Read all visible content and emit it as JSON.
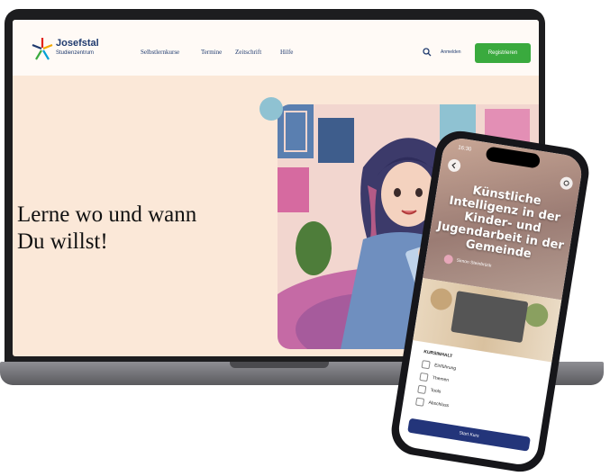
{
  "website": {
    "logo": {
      "title": "Josefstal",
      "subtitle": "Studienzentrum"
    },
    "nav": {
      "links": [
        "Selbstlernkurse",
        "Termine",
        "Zeitschrift",
        "Hilfe"
      ]
    },
    "actions": {
      "search_icon": "search-icon",
      "login_label": "Anmelden",
      "register_label": "Registrieren"
    },
    "hero": {
      "title": "Lerne wo und wann\nDu willst!"
    },
    "colors": {
      "register": "#3aaa3e",
      "hero_bg": "#fbe8d8",
      "nav_text": "#1f3a6e"
    }
  },
  "phone": {
    "status_time": "16:30",
    "course_title": "Künstliche Intelligenz in der Kinder- und Jugendarbeit in der Gemeinde",
    "author": "Simon Steinbrück",
    "curriculum": {
      "heading": "KURSINHALT",
      "items": [
        "Einführung",
        "Themen",
        "Tools",
        "Abschluss"
      ]
    },
    "start_button": "Start Kurs",
    "colors": {
      "start_button": "#23357a"
    }
  }
}
